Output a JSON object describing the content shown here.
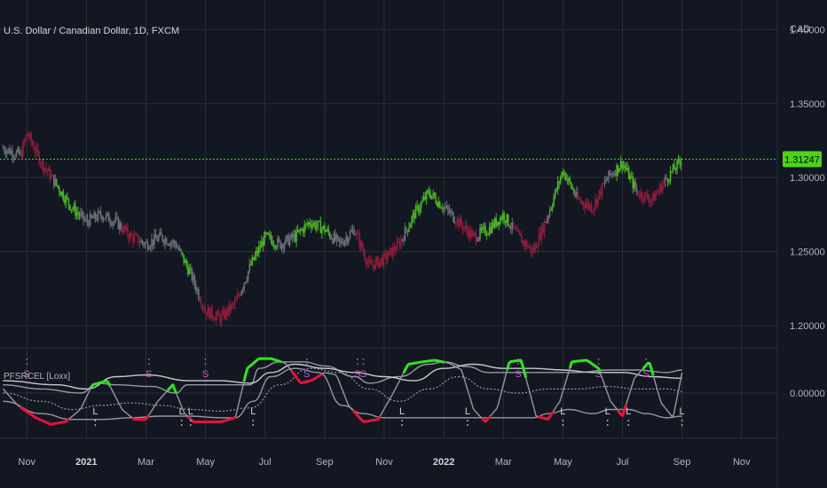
{
  "symbol_title": "U.S. Dollar / Canadian Dollar, 1D, FXCM",
  "currency": "CAD",
  "indicator_title": "PFSRCEL [Loxx]",
  "colors": {
    "background": "#131722",
    "grid": "#2a2e39",
    "bull": "#4caf28",
    "bear": "#8b1d3b",
    "neutral": "#6b6e76",
    "osc_green": "#2ee61e",
    "osc_red": "#e8113c",
    "band": "#9598a1",
    "signal_s": "#c85ec8",
    "signal_l": "#d1d4dc",
    "last_price": "#4cd418"
  },
  "chart_data": [
    {
      "type": "candlestick",
      "title": "U.S. Dollar / Canadian Dollar, 1D, FXCM",
      "y_label": "CAD",
      "y_ticks": [
        "1.40000",
        "1.35000",
        "1.30000",
        "1.25000",
        "1.20000"
      ],
      "y_tick_values": [
        1.4,
        1.35,
        1.3,
        1.25,
        1.2
      ],
      "ylim": [
        1.185,
        1.42
      ],
      "x_ticks": [
        "Nov",
        "2021",
        "Mar",
        "May",
        "Jul",
        "Sep",
        "Nov",
        "2022",
        "Mar",
        "May",
        "Jul",
        "Sep",
        "Nov"
      ],
      "x_tick_values": [
        0,
        2,
        4,
        6,
        8,
        10,
        12,
        14,
        16,
        18,
        20,
        22,
        24
      ],
      "x_unit": "months since Nov 2020",
      "xlim": [
        -0.9,
        25.2
      ],
      "last_price": 1.31247,
      "last_price_label": "1.31247",
      "close_path": {
        "x": [
          -0.8,
          -0.2,
          0.0,
          0.5,
          1.0,
          1.5,
          2.0,
          2.5,
          3.0,
          3.5,
          4.0,
          4.5,
          5.0,
          5.5,
          6.0,
          6.5,
          7.0,
          7.5,
          8.0,
          8.5,
          9.0,
          9.5,
          10.0,
          10.5,
          11.0,
          11.5,
          12.0,
          12.5,
          13.0,
          13.5,
          14.0,
          14.5,
          15.0,
          15.5,
          16.0,
          16.5,
          17.0,
          17.5,
          18.0,
          18.5,
          19.0,
          19.5,
          20.0,
          20.5,
          21.0,
          21.5,
          22.0
        ],
        "y": [
          1.32,
          1.315,
          1.33,
          1.31,
          1.295,
          1.28,
          1.27,
          1.275,
          1.27,
          1.26,
          1.255,
          1.26,
          1.255,
          1.235,
          1.21,
          1.205,
          1.215,
          1.24,
          1.26,
          1.255,
          1.26,
          1.27,
          1.265,
          1.255,
          1.265,
          1.24,
          1.245,
          1.255,
          1.275,
          1.29,
          1.28,
          1.27,
          1.26,
          1.265,
          1.275,
          1.26,
          1.25,
          1.275,
          1.305,
          1.285,
          1.28,
          1.3,
          1.31,
          1.29,
          1.285,
          1.3,
          1.312
        ]
      },
      "bull_regions": [
        [
          1.0,
          1.8
        ],
        [
          5.2,
          5.5
        ],
        [
          7.5,
          8.4
        ],
        [
          9.0,
          10.2
        ],
        [
          12.8,
          14.0
        ],
        [
          15.2,
          16.2
        ],
        [
          17.6,
          18.4
        ],
        [
          19.8,
          20.4
        ],
        [
          21.5,
          22.0
        ]
      ],
      "bear_regions": [
        [
          -0.2,
          0.9
        ],
        [
          3.2,
          3.8
        ],
        [
          5.8,
          7.2
        ],
        [
          11.0,
          12.6
        ],
        [
          14.4,
          15.1
        ],
        [
          16.3,
          17.4
        ],
        [
          18.5,
          19.4
        ],
        [
          20.5,
          21.4
        ]
      ]
    },
    {
      "type": "line",
      "title": "PFSRCEL [Loxx]",
      "y_ticks": [
        "0.00000"
      ],
      "y_tick_values": [
        0
      ],
      "ylim": [
        -0.55,
        0.55
      ],
      "xlim": [
        -0.9,
        25.2
      ],
      "series": [
        {
          "role": "oscillator",
          "x": [
            -0.8,
            -0.3,
            0.3,
            0.8,
            1.3,
            1.8,
            2.2,
            2.7,
            3.2,
            3.6,
            4.0,
            4.4,
            4.9,
            5.3,
            5.6,
            6.0,
            6.5,
            7.0,
            7.4,
            7.8,
            8.2,
            8.7,
            9.2,
            9.6,
            10.0,
            10.4,
            10.8,
            11.3,
            11.8,
            12.3,
            12.8,
            13.3,
            13.7,
            14.2,
            14.6,
            15.0,
            15.4,
            15.8,
            16.2,
            16.6,
            17.1,
            17.5,
            17.9,
            18.3,
            18.8,
            19.2,
            19.6,
            20.0,
            20.4,
            20.9,
            21.3,
            21.7,
            22.0
          ],
          "y": [
            0.05,
            -0.15,
            -0.3,
            -0.38,
            -0.35,
            -0.2,
            0.1,
            0.15,
            -0.2,
            -0.32,
            -0.32,
            -0.1,
            0.1,
            -0.25,
            -0.35,
            -0.35,
            -0.35,
            -0.3,
            0.3,
            0.42,
            0.42,
            0.36,
            0.12,
            0.16,
            0.25,
            0.22,
            -0.15,
            -0.35,
            -0.32,
            0.0,
            0.35,
            0.38,
            0.4,
            0.36,
            0.28,
            -0.2,
            -0.35,
            -0.18,
            0.38,
            0.4,
            -0.28,
            -0.32,
            -0.1,
            0.38,
            0.4,
            0.3,
            -0.1,
            -0.28,
            0.18,
            0.38,
            -0.12,
            -0.3,
            0.25
          ]
        },
        {
          "role": "upper_band",
          "x": [
            -0.8,
            0.5,
            1.8,
            2.4,
            3.0,
            4.2,
            5.0,
            5.4,
            6.5,
            7.5,
            7.8,
            8.5,
            9.3,
            10.0,
            11.0,
            11.5,
            12.5,
            13.5,
            14.0,
            14.8,
            15.5,
            16.5,
            17.5,
            18.5,
            19.5,
            20.5,
            21.5,
            22.0
          ],
          "y": [
            0.1,
            0.05,
            0.0,
            0.12,
            0.1,
            0.08,
            0.0,
            0.1,
            0.1,
            0.1,
            0.3,
            0.38,
            0.38,
            0.33,
            0.2,
            0.12,
            0.2,
            0.35,
            0.38,
            0.32,
            0.25,
            0.25,
            0.25,
            0.25,
            0.28,
            0.28,
            0.25,
            0.28
          ]
        },
        {
          "role": "middle",
          "x": [
            -0.8,
            0.5,
            1.5,
            2.5,
            3.5,
            4.5,
            5.5,
            6.5,
            7.5,
            8.5,
            9.5,
            10.5,
            11.5,
            12.5,
            13.5,
            14.5,
            15.5,
            16.5,
            17.5,
            18.5,
            19.5,
            20.5,
            21.5,
            22.0
          ],
          "y": [
            0.0,
            -0.1,
            -0.2,
            -0.15,
            -0.12,
            -0.15,
            -0.2,
            -0.22,
            -0.18,
            0.1,
            0.3,
            0.25,
            0.05,
            -0.1,
            0.05,
            0.2,
            0.05,
            0.0,
            0.05,
            0.05,
            0.08,
            0.05,
            0.05,
            0.02
          ]
        },
        {
          "role": "lower_band",
          "x": [
            -0.8,
            0.5,
            1.5,
            2.5,
            3.5,
            4.5,
            5.5,
            6.5,
            7.0,
            7.6,
            8.2,
            9.0,
            9.8,
            10.6,
            11.3,
            12.0,
            13.0,
            14.0,
            15.0,
            16.0,
            17.0,
            17.5,
            18.2,
            19.0,
            19.6,
            20.2,
            20.8,
            21.5,
            22.0
          ],
          "y": [
            -0.1,
            -0.25,
            -0.32,
            -0.32,
            -0.3,
            -0.28,
            -0.28,
            -0.3,
            -0.3,
            -0.1,
            0.2,
            0.3,
            0.25,
            -0.15,
            -0.25,
            -0.3,
            -0.3,
            -0.3,
            -0.3,
            -0.3,
            -0.3,
            -0.25,
            -0.2,
            -0.25,
            -0.2,
            -0.2,
            -0.25,
            -0.3,
            -0.28
          ]
        },
        {
          "role": "upper_band_2",
          "x": [
            -0.8,
            1.0,
            2.0,
            3.0,
            4.0,
            5.5,
            6.5,
            7.5,
            8.2,
            9.0,
            10.0,
            11.0,
            12.0,
            13.0,
            14.0,
            15.0,
            16.0,
            17.0,
            18.0,
            19.0,
            20.0,
            21.0,
            22.0
          ],
          "y": [
            0.15,
            0.1,
            0.05,
            0.2,
            0.22,
            0.15,
            0.15,
            0.12,
            0.25,
            0.35,
            0.3,
            0.25,
            0.2,
            0.15,
            0.3,
            0.35,
            0.3,
            0.3,
            0.28,
            0.25,
            0.25,
            0.2,
            0.18
          ]
        }
      ],
      "signals": [
        {
          "x": 0.0,
          "label": "S",
          "pos": "top"
        },
        {
          "x": 4.1,
          "label": "S",
          "pos": "top"
        },
        {
          "x": 6.0,
          "label": "S",
          "pos": "top"
        },
        {
          "x": 9.4,
          "label": "S",
          "pos": "top"
        },
        {
          "x": 11.1,
          "label": "S",
          "pos": "top"
        },
        {
          "x": 11.3,
          "label": "S",
          "pos": "top"
        },
        {
          "x": 16.5,
          "label": "S",
          "pos": "top"
        },
        {
          "x": 19.2,
          "label": "S",
          "pos": "top"
        },
        {
          "x": 20.8,
          "label": "S",
          "pos": "top"
        },
        {
          "x": 2.3,
          "label": "L",
          "pos": "bottom"
        },
        {
          "x": 5.2,
          "label": "L",
          "pos": "bottom"
        },
        {
          "x": 5.5,
          "label": "L",
          "pos": "bottom"
        },
        {
          "x": 7.6,
          "label": "L",
          "pos": "bottom"
        },
        {
          "x": 12.6,
          "label": "L",
          "pos": "bottom"
        },
        {
          "x": 14.8,
          "label": "L",
          "pos": "bottom"
        },
        {
          "x": 18.0,
          "label": "L",
          "pos": "bottom"
        },
        {
          "x": 19.5,
          "label": "L",
          "pos": "bottom"
        },
        {
          "x": 20.2,
          "label": "L",
          "pos": "bottom"
        },
        {
          "x": 22.0,
          "label": "L",
          "pos": "bottom"
        }
      ]
    }
  ]
}
